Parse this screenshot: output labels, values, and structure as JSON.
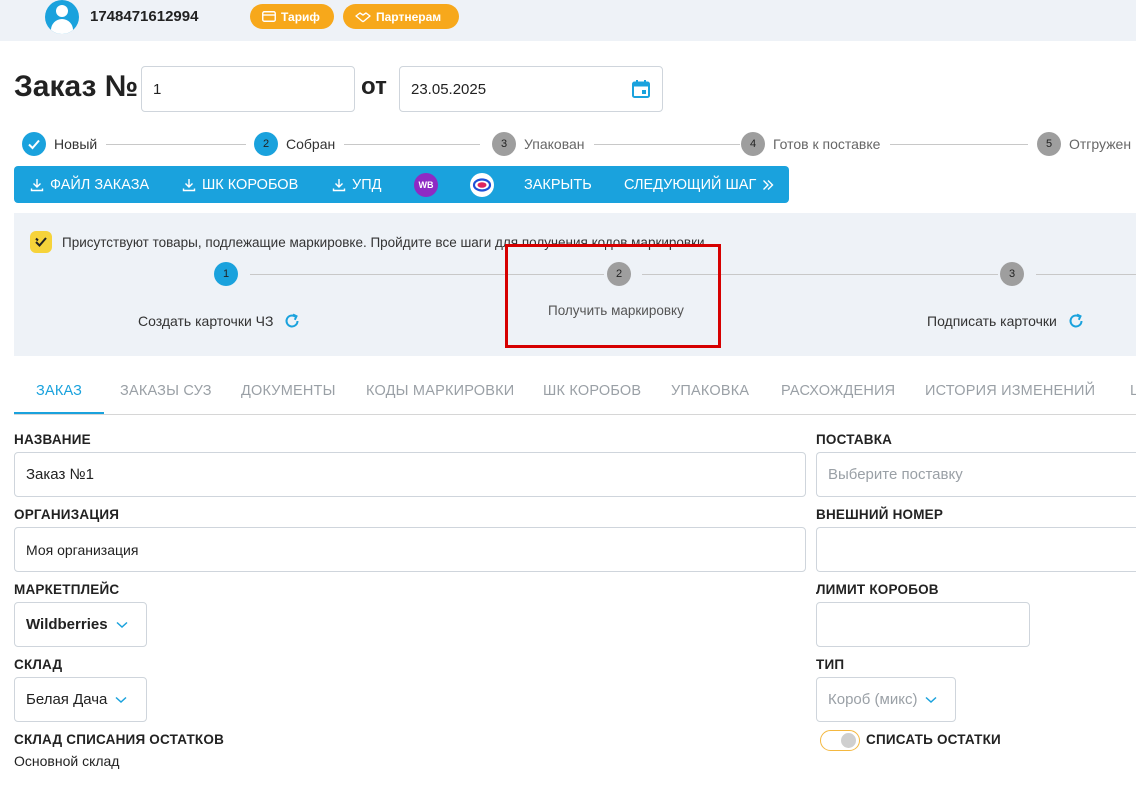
{
  "topbar": {
    "user_id": "1748471612994",
    "tariff_label": "Тариф",
    "partners_label": "Партнерам"
  },
  "order": {
    "title": "Заказ №",
    "number": "1",
    "ot_label": "от",
    "date": "23.05.2025"
  },
  "status_steps": [
    {
      "num": "",
      "label": "Новый",
      "state": "done"
    },
    {
      "num": "2",
      "label": "Собран",
      "state": "active"
    },
    {
      "num": "3",
      "label": "Упакован",
      "state": "pending"
    },
    {
      "num": "4",
      "label": "Готов к поставке",
      "state": "pending"
    },
    {
      "num": "5",
      "label": "Отгружен",
      "state": "pending"
    }
  ],
  "actions": {
    "order_file": "ФАЙЛ ЗАКАЗА",
    "box_barcodes": "ШК КОРОБОВ",
    "upd": "УПД",
    "wb_icon": "WB",
    "ozon_icon": "ozon-icon",
    "close": "ЗАКРЫТЬ",
    "next_step": "СЛЕДУЮЩИЙ ШАГ"
  },
  "marking": {
    "note": "Присутствуют товары, подлежащие маркировке. Пройдите все шаги для получения кодов маркировки.",
    "steps": [
      {
        "num": "1",
        "label": "Создать карточки ЧЗ"
      },
      {
        "num": "2",
        "label": "Получить маркировку"
      },
      {
        "num": "3",
        "label": "Подписать карточки"
      }
    ]
  },
  "tabs": [
    "ЗАКАЗ",
    "ЗАКАЗЫ СУЗ",
    "ДОКУМЕНТЫ",
    "КОДЫ МАРКИРОВКИ",
    "ШК КОРОБОВ",
    "УПАКОВКА",
    "РАСХОЖДЕНИЯ",
    "ИСТОРИЯ ИЗМЕНЕНИЙ",
    "Ш"
  ],
  "form": {
    "name_label": "НАЗВАНИЕ",
    "name_value": "Заказ №1",
    "supply_label": "ПОСТАВКА",
    "supply_placeholder": "Выберите поставку",
    "org_label": "ОРГАНИЗАЦИЯ",
    "org_value": "Моя организация",
    "ext_num_label": "ВНЕШНИЙ НОМЕР",
    "ext_num_value": "",
    "marketplace_label": "МАРКЕТПЛЕЙС",
    "marketplace_value": "Wildberries",
    "box_limit_label": "ЛИМИТ КОРОБОВ",
    "box_limit_value": "",
    "warehouse_label": "СКЛАД",
    "warehouse_value": "Белая Дача",
    "type_label": "ТИП",
    "type_value": "Короб (микс)",
    "writeoff_wh_label": "СКЛАД СПИСАНИЯ ОСТАТКОВ",
    "writeoff_wh_value": "Основной склад",
    "writeoff_toggle_label": "СПИСАТЬ ОСТАТКИ",
    "writeoff_toggle_on": false
  },
  "colors": {
    "accent": "#1aa2dd",
    "orange": "#f7a81b",
    "highlight": "#d60000"
  }
}
